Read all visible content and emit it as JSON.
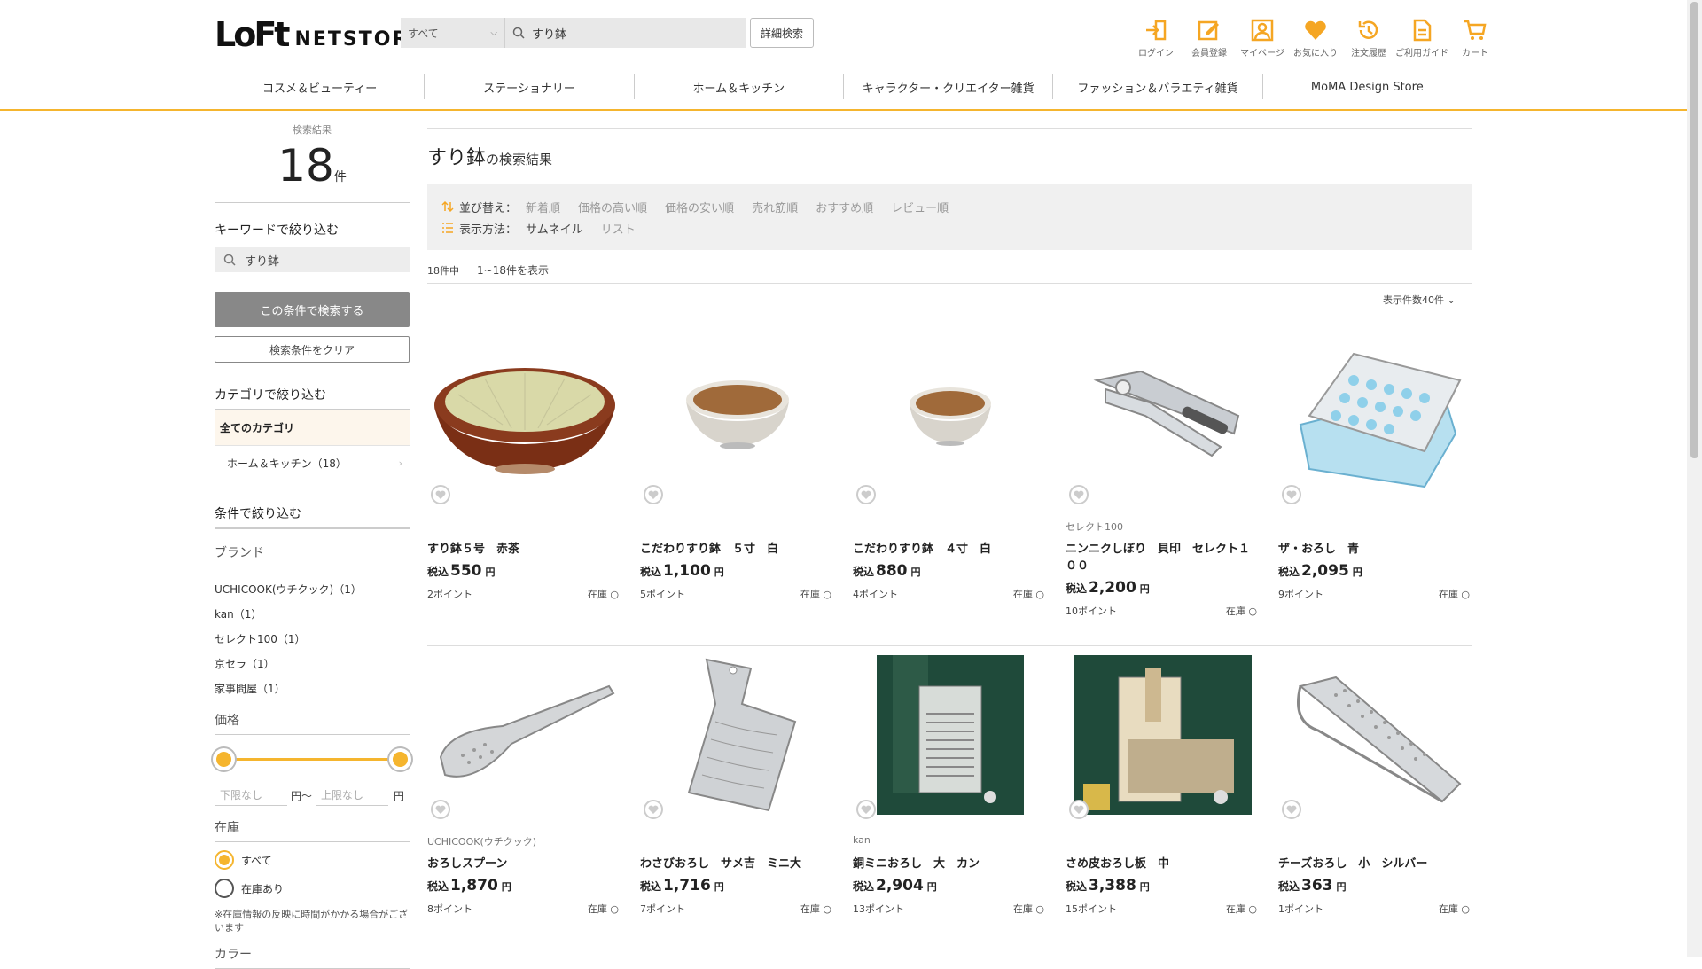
{
  "header": {
    "logo_mark": "LoFt",
    "logo_text": "NETSTORE",
    "search_category": "すべて",
    "search_query": "すり鉢",
    "detail_search": "詳細検索",
    "icons": [
      {
        "label": "ログイン",
        "icon": "login-icon"
      },
      {
        "label": "会員登録",
        "icon": "register-icon"
      },
      {
        "label": "マイページ",
        "icon": "mypage-icon"
      },
      {
        "label": "お気に入り",
        "icon": "heart-icon"
      },
      {
        "label": "注文履歴",
        "icon": "history-icon"
      },
      {
        "label": "ご利用ガイド",
        "icon": "guide-icon"
      },
      {
        "label": "カート",
        "icon": "cart-icon"
      }
    ],
    "accent_color": "#f5b52e"
  },
  "nav": [
    "コスメ＆ビューティー",
    "ステーショナリー",
    "ホーム＆キッチン",
    "キャラクター・クリエイター雑貨",
    "ファッション＆バラエティ雑貨",
    "MoMA Design Store"
  ],
  "sidebar": {
    "result_label": "検索結果",
    "result_count": "18",
    "result_unit": "件",
    "keyword_title": "キーワードで絞り込む",
    "keyword_value": "すり鉢",
    "search_button": "この条件で検索する",
    "clear_button": "検索条件をクリア",
    "category_title": "カテゴリで絞り込む",
    "category_all": "全てのカテゴリ",
    "category_item": "ホーム＆キッチン（18）",
    "condition_title": "条件で絞り込む",
    "brand_title": "ブランド",
    "brands": [
      "UCHICOOK(ウチクック)（1）",
      "kan（1）",
      "セレクト100（1）",
      "京セラ（1）",
      "家事問屋（1）"
    ],
    "price_title": "価格",
    "price_min_placeholder": "下限なし",
    "price_max_placeholder": "上限なし",
    "yen_tilde": "円～",
    "yen": "円",
    "stock_title": "在庫",
    "stock_all": "すべて",
    "stock_in": "在庫あり",
    "stock_note": "※在庫情報の反映に時間がかかる場合がございます",
    "color_title": "カラー"
  },
  "main": {
    "title_query": "すり鉢",
    "title_suffix": "の検索結果",
    "sort_label": "並び替え：",
    "sort_options": [
      "新着順",
      "価格の高い順",
      "価格の安い順",
      "売れ筋順",
      "おすすめ順",
      "レビュー順"
    ],
    "view_label": "表示方法：",
    "view_options": [
      "サムネイル",
      "リスト"
    ],
    "count_total": "18件中",
    "count_range": "1~18件を表示",
    "per_page": "表示件数40件 ⌄"
  },
  "products": [
    {
      "brand": "",
      "name": "すり鉢５号　赤茶",
      "tax": "税込",
      "price": "550",
      "yen": "円",
      "points": "2ポイント",
      "stock": "在庫 ○",
      "img": "bowl-brown"
    },
    {
      "brand": "",
      "name": "こだわりすり鉢　５寸　白",
      "tax": "税込",
      "price": "1,100",
      "yen": "円",
      "points": "5ポイント",
      "stock": "在庫 ○",
      "img": "bowl-white"
    },
    {
      "brand": "",
      "name": "こだわりすり鉢　４寸　白",
      "tax": "税込",
      "price": "880",
      "yen": "円",
      "points": "4ポイント",
      "stock": "在庫 ○",
      "img": "bowl-white-small"
    },
    {
      "brand": "セレクト100",
      "name": "ニンニクしぼり　貝印　セレクト１００",
      "tax": "税込",
      "price": "2,200",
      "yen": "円",
      "points": "10ポイント",
      "stock": "在庫 ○",
      "img": "garlic-press"
    },
    {
      "brand": "",
      "name": "ザ・おろし　青",
      "tax": "税込",
      "price": "2,095",
      "yen": "円",
      "points": "9ポイント",
      "stock": "在庫 ○",
      "img": "grater-box"
    },
    {
      "brand": "UCHICOOK(ウチクック)",
      "name": "おろしスプーン",
      "tax": "税込",
      "price": "1,870",
      "yen": "円",
      "points": "8ポイント",
      "stock": "在庫 ○",
      "img": "spoon"
    },
    {
      "brand": "",
      "name": "わさびおろし　サメ吉　ミニ大",
      "tax": "税込",
      "price": "1,716",
      "yen": "円",
      "points": "7ポイント",
      "stock": "在庫 ○",
      "img": "wasabi-paddle"
    },
    {
      "brand": "kan",
      "name": "銅ミニおろし　大　カン",
      "tax": "税込",
      "price": "2,904",
      "yen": "円",
      "points": "13ポイント",
      "stock": "在庫 ○",
      "img": "copper-grater"
    },
    {
      "brand": "",
      "name": "さめ皮おろし板　中",
      "tax": "税込",
      "price": "3,388",
      "yen": "円",
      "points": "15ポイント",
      "stock": "在庫 ○",
      "img": "shark-grater"
    },
    {
      "brand": "",
      "name": "チーズおろし　小　シルバー",
      "tax": "税込",
      "price": "363",
      "yen": "円",
      "points": "1ポイント",
      "stock": "在庫 ○",
      "img": "cheese-grater"
    }
  ]
}
